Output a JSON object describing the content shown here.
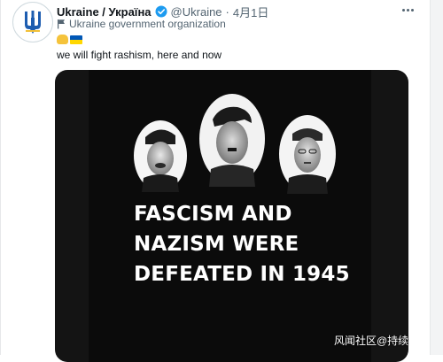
{
  "tweet": {
    "display_name": "Ukraine / Україна",
    "handle": "@Ukraine",
    "separator": "·",
    "date": "4月1日",
    "affiliation": "Ukraine government organization",
    "text": "we will fight rashism, here and now"
  },
  "media": {
    "caption_lines": [
      "FASCISM AND",
      "NAZISM WERE",
      "DEFEATED IN 1945"
    ]
  },
  "watermark": "风闻社区@持续",
  "colors": {
    "verified": "#1d9bf0",
    "trident": "#f2c037",
    "flag_blue": "#0057b7",
    "flag_yellow": "#ffd700",
    "media_bg": "#141414"
  }
}
